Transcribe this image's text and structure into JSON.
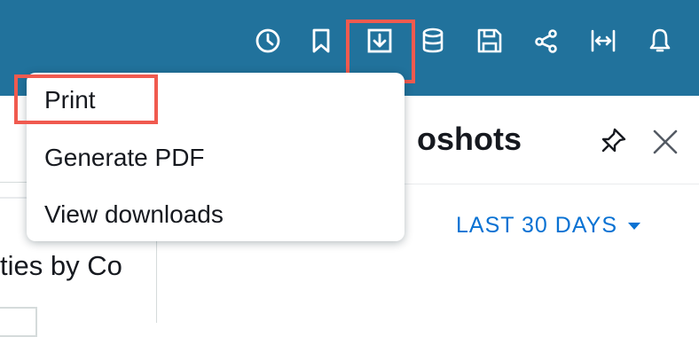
{
  "toolbar": {
    "icons": [
      "clock-icon",
      "bookmark-icon",
      "download-icon",
      "database-icon",
      "save-icon",
      "share-icon",
      "fit-width-icon",
      "bell-icon"
    ],
    "background_color": "#21729c",
    "highlight_color": "#f05a4f"
  },
  "menu": {
    "items": [
      {
        "label": "Print"
      },
      {
        "label": "Generate PDF"
      },
      {
        "label": "View downloads"
      }
    ]
  },
  "panel": {
    "title_partial": "oshots",
    "date_range": "LAST 30 DAYS",
    "accent_color": "#0972d3"
  },
  "left": {
    "title_partial": "ties by Co"
  }
}
